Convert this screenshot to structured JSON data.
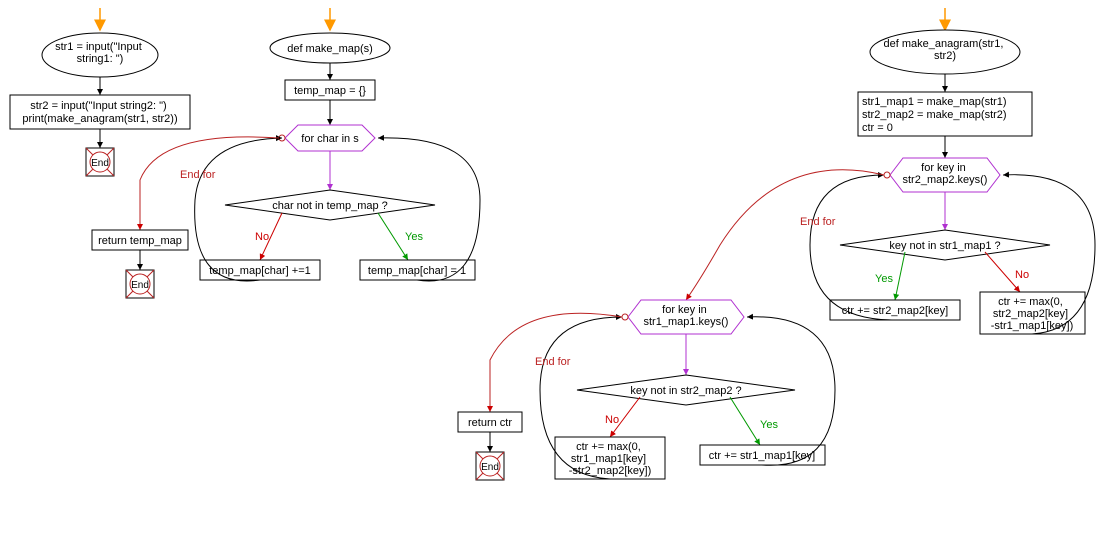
{
  "flowchart1": {
    "start_box": "str1 = input(\"Input\nstring1: \")",
    "process1": "str2 = input(\"Input string2: \")\nprint(make_anagram(str1, str2))",
    "end": "End"
  },
  "flowchart2": {
    "start_box": "def make_map(s)",
    "process1": "temp_map = {}",
    "loop": "for char in s",
    "decision": "char not in temp_map ?",
    "yes_branch": "temp_map[char] = 1",
    "no_branch": "temp_map[char] +=1",
    "end_for_label": "End for",
    "return": "return temp_map",
    "end": "End",
    "yes_label": "Yes",
    "no_label": "No"
  },
  "flowchart3": {
    "start_box": "def make_anagram(str1,\nstr2)",
    "process1": "str1_map1 = make_map(str1)\nstr2_map2 = make_map(str2)\nctr = 0",
    "loop1": "for key in\nstr2_map2.keys()",
    "decision1": "key not in str1_map1 ?",
    "yes1": "ctr += str2_map2[key]",
    "no1": "ctr += max(0,\nstr2_map2[key]\n-str1_map1[key])",
    "end_for1": "End for",
    "loop2": "for key in\nstr1_map1.keys()",
    "decision2": "key not in str2_map2 ?",
    "yes2": "ctr += str1_map1[key]",
    "no2": "ctr += max(0,\nstr1_map1[key]\n-str2_map2[key])",
    "end_for2": "End for",
    "return": "return ctr",
    "end": "End",
    "yes_label": "Yes",
    "no_label": "No"
  }
}
